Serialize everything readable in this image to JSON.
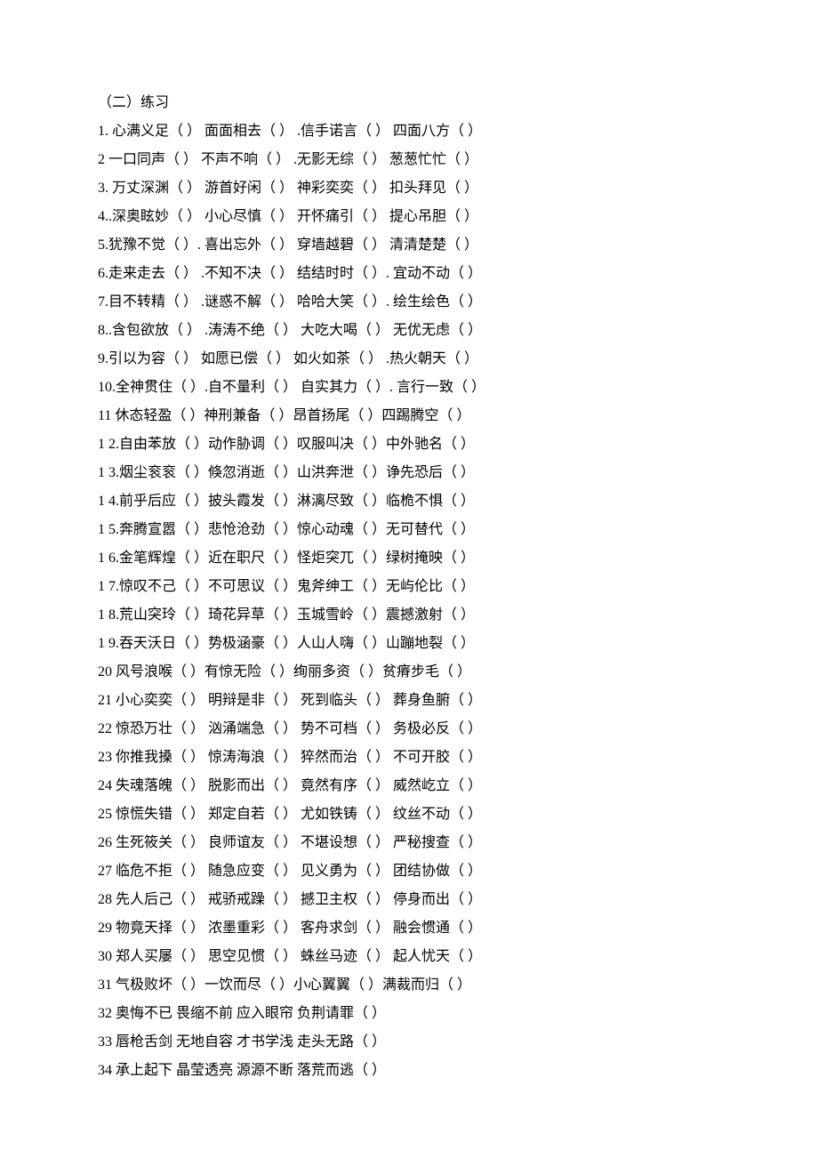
{
  "title": "（二）练习",
  "lines": [
    "1.  心满义足（   ）  面面相去（   ） .信手诺言（   ）      四面八方（   ）",
    "2 一口同声（    ）  不声不响（    ） .无影无综（    ）     葱葱忙忙（    ）",
    "3.  万丈深渊（   ）  游首好闲（    ）   神彩奕奕（    ）    扣头拜见（    ）",
    "4..深奥眩妙（    ）  小心尽慎（    ）    开怀痛引（    ）   提心吊胆（    ）",
    "5.犹豫不觉（    ）.  喜出忘外（    ）    穿墙越碧（    ）    清清楚楚（    ）",
    "6.走来走去（    ） .不知不决（    ）   结结时时（    ）.    宜动不动（    ）",
    "7.目不转精（    ） .谜惑不解（    ）    哈哈大笑（    ）.   绘生绘色（    ）",
    "8..含包欲放（    ）  .涛涛不绝（    ）    大吃大喝（    ）    无优无虑（    ）",
    "9.引以为容（    ）  如愿已偿（    ）    如火如茶（    ）  .热火朝天（    ）",
    "10.全神贯住（    ）.自不量利（    ）   自实其力（    ）.  言行一致（    ）",
    "11 休态轻盈（    ）神刑兼备（    ）昂首扬尾（    ）四踢腾空（     ）",
    "1 2.自由苯放（      ）动作胁调（      ）叹服叫决（      ）中外驰名（      ）",
    "1 3.烟尘衮衮（      ）倏忽消逝（      ）山洪奔泄（      ）诤先恐后（      ）",
    "1 4.前乎后应（      ）披头霞发（      ）淋漓尽致（      ）临桅不惧（      ）",
    "1 5.奔腾宣嚣（      ）悲怆沧劲（      ）惊心动魂（      ）无可替代（      ）",
    "1 6.金笔辉煌（      ）近在职尺（      ）怪炬突兀（      ）绿树掩映（      ）",
    "1 7.惊叹不己（      ）不可思议（      ）鬼斧绅工（      ）无屿伦比（      ）",
    "1 8.荒山突玲（      ）琦花异草（      ）玉城雪岭（      ）震撼激射（      ）",
    "1 9.吞天沃日（      ）势极涵豪（      ）人山人嗨（      ）山蹦地裂（      ）",
    "20 风号浪喉（      ）有惊无险（    ）绚丽多资（    ）贫瘠步毛（     ）",
    "21 小心奕奕（    ）  明辩是非（    ）     死到临头（    ）     葬身鱼腑（    ）",
    "22 惊恐万壮（    ）  汹涌端急（    ）     势不可档（    ）     务极必反（    ）",
    "23 你推我搡（    ）  惊涛海浪（    ）     猝然而治（    ）     不可开胶（    ）",
    "24 失魂落魄（    ）  脱影而出（    ）     竟然有序（    ）     威然屹立（    ）",
    "25 惊慌失错（    ）  郑定自若（    ）     尤如铁铸（    ）     纹丝不动（    ）",
    "26 生死筱关（    ）  良师谊友（    ）     不堪设想（    ）     严秘搜查（    ）",
    "27 临危不拒（    ）  随急应变（    ）     见义勇为（    ）     团结协做（    ）",
    "28 先人后己（    ）  戒骄戒躁（    ）     撼卫主权（    ）     停身而出（    ）",
    "29 物竟天择（    ）  浓墨重彩（    ）     客舟求剑（    ）     融会惯通（    ）",
    "30 郑人买屡（    ）  思空见惯（    ）     蛛丝马迹（    ）     起人忧天（    ）",
    "31 气极败坏（  ）一饮而尽（  ）小心翼翼（  ）满裁而归（    ）",
    "32 奥悔不已      畏缩不前       应入眼帘      负荆请罪（    ）",
    "33 唇枪舌剑      无地自容      才书学浅      走头无路（    ）",
    "34 承上起下      晶莹透亮      源源不断      落荒而逃（    ）"
  ]
}
